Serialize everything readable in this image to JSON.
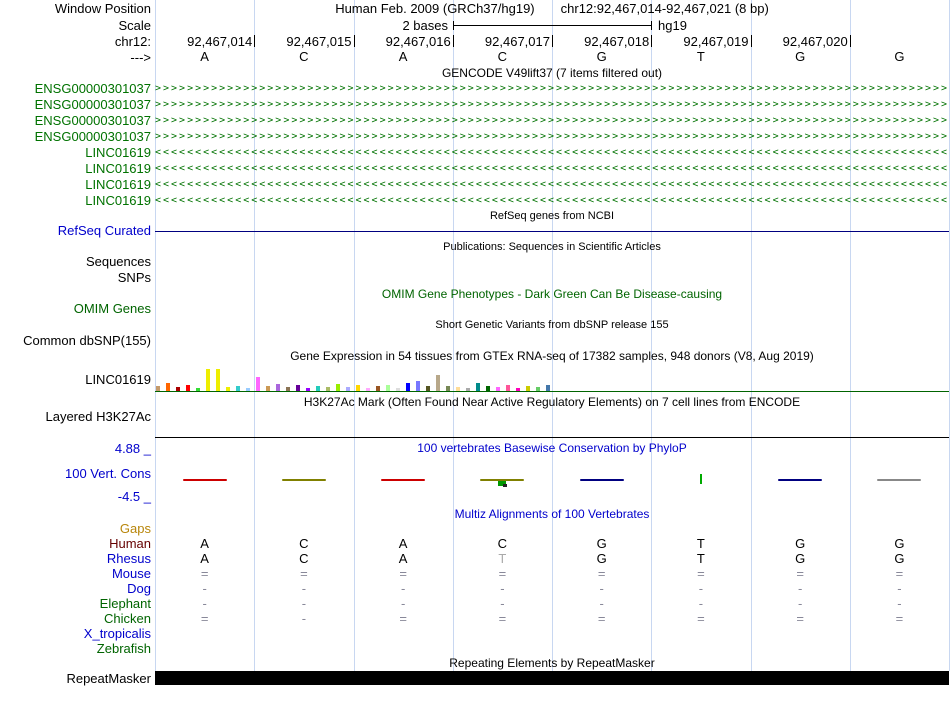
{
  "colors": {
    "guideline": "#c8d7f1",
    "track_blue": "#0000cc",
    "gene_green": "#007200",
    "dark_green": "#006400",
    "navy": "#000080",
    "gaps_orange": "#b8860b",
    "black": "#000000"
  },
  "header": {
    "row_labels": {
      "window_position": "Window Position",
      "scale": "Scale",
      "chrom": "chr12:",
      "strand": "--->"
    },
    "assembly": "Human Feb. 2009 (GRCh37/hg19)",
    "position": "chr12:92,467,014-92,467,021 (8 bp)",
    "scale_value": "2 bases",
    "genome": "hg19",
    "coordinates": [
      "92,467,014",
      "92,467,015",
      "92,467,016",
      "92,467,017",
      "92,467,018",
      "92,467,019",
      "92,467,020"
    ],
    "bases": [
      "A",
      "C",
      "A",
      "C",
      "G",
      "T",
      "G",
      "G"
    ]
  },
  "gencode": {
    "title": "GENCODE V49lift37 (7 items filtered out)",
    "genes": [
      {
        "label": "ENSG00000301037",
        "direction": "right"
      },
      {
        "label": "ENSG00000301037",
        "direction": "right"
      },
      {
        "label": "ENSG00000301037",
        "direction": "right"
      },
      {
        "label": "ENSG00000301037",
        "direction": "right"
      },
      {
        "label": "LINC01619",
        "direction": "left"
      },
      {
        "label": "LINC01619",
        "direction": "left"
      },
      {
        "label": "LINC01619",
        "direction": "left"
      },
      {
        "label": "LINC01619",
        "direction": "left"
      }
    ]
  },
  "refseq": {
    "title": "RefSeq genes from NCBI",
    "label": "RefSeq Curated",
    "track_color": "#000080"
  },
  "publications": {
    "title": "Publications: Sequences in Scientific Articles",
    "sequences_label": "Sequences",
    "snps_label": "SNPs"
  },
  "omim": {
    "title": "OMIM Gene Phenotypes - Dark Green Can Be Disease-causing",
    "label": "OMIM Genes"
  },
  "dbsnp": {
    "title": "Short Genetic Variants from dbSNP release 155",
    "label": "Common dbSNP(155)"
  },
  "gtex": {
    "title": "Gene Expression in 54 tissues from GTEx RNA-seq of 17382 samples, 948 donors (V8, Aug 2019)",
    "label": "LINC01619",
    "baseline_color": "#006400",
    "bars": [
      {
        "h": 5,
        "c": "#c49a6c"
      },
      {
        "h": 8,
        "c": "#ff6600"
      },
      {
        "h": 4,
        "c": "#aa0000"
      },
      {
        "h": 6,
        "c": "#ff0000"
      },
      {
        "h": 3,
        "c": "#33dd33"
      },
      {
        "h": 22,
        "c": "#eeee00"
      },
      {
        "h": 22,
        "c": "#eeee00"
      },
      {
        "h": 4,
        "c": "#eeee00"
      },
      {
        "h": 5,
        "c": "#33cccc"
      },
      {
        "h": 3,
        "c": "#99ccff"
      },
      {
        "h": 14,
        "c": "#ff66ff"
      },
      {
        "h": 5,
        "c": "#cc9955"
      },
      {
        "h": 7,
        "c": "#aa66dd"
      },
      {
        "h": 4,
        "c": "#8b7355"
      },
      {
        "h": 6,
        "c": "#660099"
      },
      {
        "h": 3,
        "c": "#9900ff"
      },
      {
        "h": 5,
        "c": "#22ccbb"
      },
      {
        "h": 4,
        "c": "#aabb66"
      },
      {
        "h": 7,
        "c": "#99ee00"
      },
      {
        "h": 4,
        "c": "#aaaaff"
      },
      {
        "h": 6,
        "c": "#ffd700"
      },
      {
        "h": 3,
        "c": "#ffaaff"
      },
      {
        "h": 5,
        "c": "#995522"
      },
      {
        "h": 6,
        "c": "#aaff99"
      },
      {
        "h": 3,
        "c": "#dddddd"
      },
      {
        "h": 8,
        "c": "#0000ff"
      },
      {
        "h": 10,
        "c": "#7777ff"
      },
      {
        "h": 5,
        "c": "#555522"
      },
      {
        "h": 16,
        "c": "#b8a88a"
      },
      {
        "h": 5,
        "c": "#778855"
      },
      {
        "h": 4,
        "c": "#ffdd99"
      },
      {
        "h": 3,
        "c": "#aaaaaa"
      },
      {
        "h": 8,
        "c": "#008b8b"
      },
      {
        "h": 5,
        "c": "#006600"
      },
      {
        "h": 4,
        "c": "#ff66ff"
      },
      {
        "h": 6,
        "c": "#ff5599"
      },
      {
        "h": 3,
        "c": "#ff00bb"
      },
      {
        "h": 5,
        "c": "#cccc00"
      },
      {
        "h": 4,
        "c": "#66cc66"
      },
      {
        "h": 6,
        "c": "#4477aa"
      }
    ]
  },
  "h3k27ac": {
    "title": "H3K27Ac Mark (Often Found Near Active Regulatory Elements) on 7 cell lines from ENCODE",
    "label": "Layered H3K27Ac"
  },
  "conservation": {
    "title": "100 vertebrates Basewise Conservation by PhyloP",
    "label": "100 Vert. Cons",
    "max_label": "4.88 _",
    "min_label": "-4.5 _",
    "marks": [
      {
        "col": 0,
        "type": "wave",
        "color": "#cc0000"
      },
      {
        "col": 1,
        "type": "wave",
        "color": "#808000"
      },
      {
        "col": 2,
        "type": "wave",
        "color": "#cc0000"
      },
      {
        "col": 3,
        "type": "wave",
        "color": "#808000",
        "extra": "#009900"
      },
      {
        "col": 4,
        "type": "wave",
        "color": "#000080"
      },
      {
        "col": 5,
        "type": "tick",
        "color": "#00aa00"
      },
      {
        "col": 6,
        "type": "wave",
        "color": "#000080"
      },
      {
        "col": 7,
        "type": "wave",
        "color": "#888888"
      }
    ]
  },
  "multiz": {
    "title": "Multiz Alignments of 100 Vertebrates",
    "gaps_label": "Gaps",
    "rows": [
      {
        "name": "Human",
        "name_color": "#660000",
        "cell_color": "#000000",
        "cells": [
          "A",
          "C",
          "A",
          "C",
          "G",
          "T",
          "G",
          "G"
        ]
      },
      {
        "name": "Rhesus",
        "name_color": "#0000cc",
        "cell_color": "#000000",
        "cells": [
          "A",
          "C",
          "A",
          "T",
          "G",
          "T",
          "G",
          "G"
        ],
        "overrides": {
          "3": "#aaaaaa"
        }
      },
      {
        "name": "Mouse",
        "name_color": "#0000cc",
        "cell_color": "#888899",
        "cells": [
          "=",
          "=",
          "=",
          "=",
          "=",
          "=",
          "=",
          "="
        ]
      },
      {
        "name": "Dog",
        "name_color": "#0000cc",
        "cell_color": "#888899",
        "cells": [
          "-",
          "-",
          "-",
          "-",
          "-",
          "-",
          "-",
          "-"
        ]
      },
      {
        "name": "Elephant",
        "name_color": "#006400",
        "cell_color": "#888899",
        "cells": [
          "-",
          "-",
          "-",
          "-",
          "-",
          "-",
          "-",
          "-"
        ]
      },
      {
        "name": "Chicken",
        "name_color": "#006400",
        "cell_color": "#888899",
        "cells": [
          "=",
          "-",
          "=",
          "=",
          "=",
          "=",
          "=",
          "="
        ]
      },
      {
        "name": "X_tropicalis",
        "name_color": "#0000cc",
        "cell_color": "#888899",
        "cells": [
          "",
          "",
          "",
          "",
          "",
          "",
          "",
          ""
        ]
      },
      {
        "name": "Zebrafish",
        "name_color": "#006400",
        "cell_color": "#888899",
        "cells": [
          "",
          "",
          "",
          "",
          "",
          "",
          "",
          ""
        ]
      }
    ]
  },
  "repeatmasker": {
    "title": "Repeating Elements by RepeatMasker",
    "label": "RepeatMasker",
    "bar_color": "#000000"
  }
}
